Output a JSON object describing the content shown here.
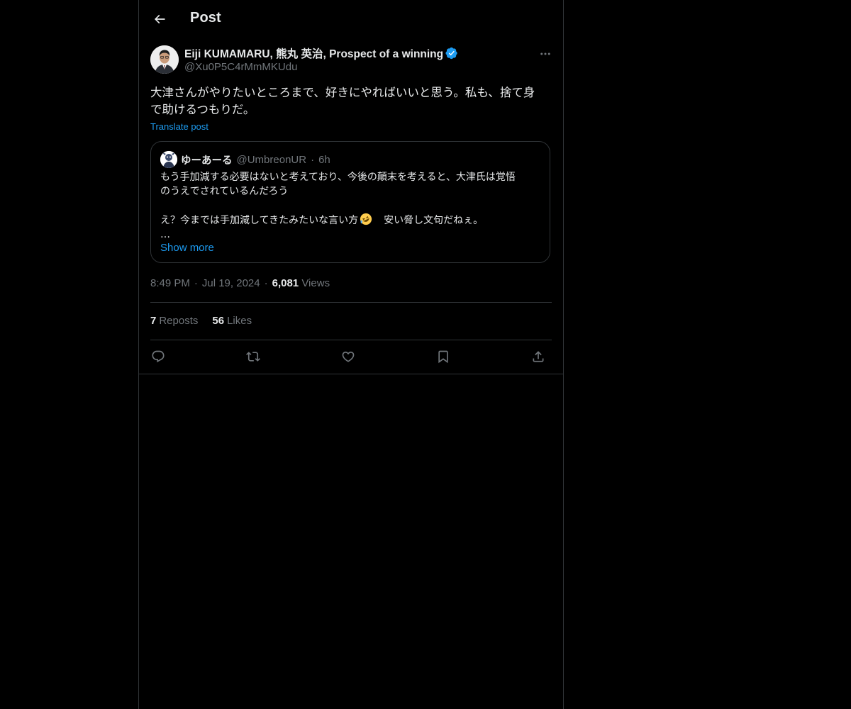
{
  "header": {
    "title": "Post"
  },
  "post": {
    "author_name": "Eiji KUMAMARU, 熊丸 英治, Prospect of a winning",
    "author_handle": "@Xu0P5C4rMmMKUdu",
    "text_line1": "大津さんがやりたいところまで、好きにやればいいと思う。私も、捨て身",
    "text_line2": "で助けるつもりだ。",
    "translate_label": "Translate post",
    "time": "8:49 PM",
    "date": "Jul 19, 2024",
    "views_count": "6,081",
    "views_label": "Views",
    "reposts_count": "7",
    "reposts_label": "Reposts",
    "likes_count": "56",
    "likes_label": "Likes",
    "meta_separator": "·"
  },
  "quote": {
    "name": "ゆーあーる",
    "handle": "@UmbreonUR",
    "separator": "·",
    "time": "6h",
    "line1": "もう手加減する必要はないと考えており、今後の顛末を考えると、大津氏は覚悟",
    "line2": "のうえでされているんだろう",
    "line3_before_emoji": "え？今までは手加減してきたみたいな言い方",
    "emoji": "rolling-on-the-floor-laughing-emoji",
    "line3_after_emoji": "　安い脅し文句だねぇ。",
    "ellipsis": "…",
    "show_more_label": "Show more"
  },
  "icons": {
    "back": "arrow-left-icon",
    "more": "more-horizontal-icon",
    "verified": "verified-badge-icon",
    "reply": "reply-icon",
    "repost": "repost-icon",
    "like": "heart-icon",
    "bookmark": "bookmark-icon",
    "share": "share-icon"
  },
  "colors": {
    "background": "#000000",
    "text": "#e7e9ea",
    "secondary": "#71767b",
    "accent": "#1d9bf0",
    "border": "#2f3336"
  }
}
